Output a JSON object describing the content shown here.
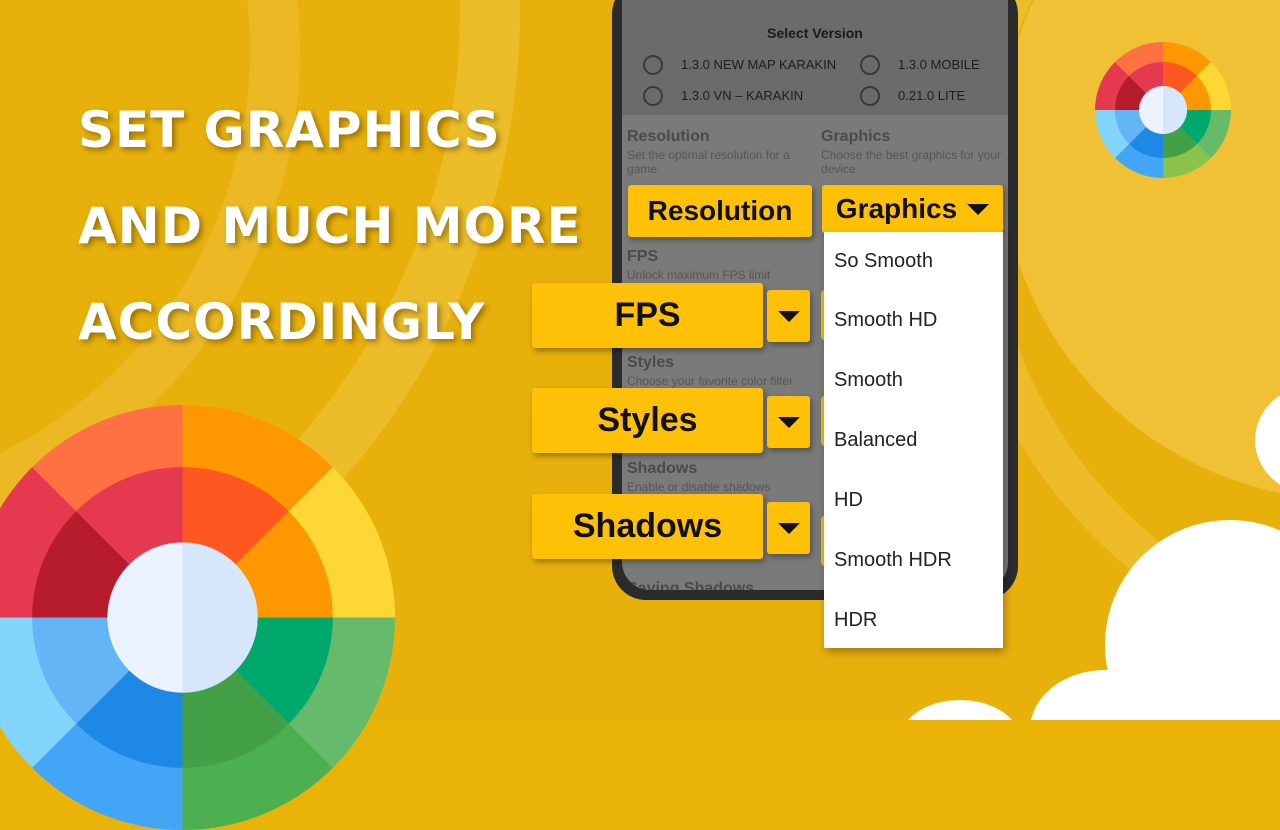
{
  "headline": {
    "lines": [
      "Set Graphics",
      "and much more",
      "accordingly"
    ]
  },
  "phone_screen": {
    "select_version": {
      "title": "Select Version",
      "options": [
        {
          "label": "1.3.0 NEW MAP KARAKIN",
          "selected": false
        },
        {
          "label": "1.3.0 MOBILE",
          "selected": false
        },
        {
          "label": "1.3.0 VN – KARAKIN",
          "selected": false
        },
        {
          "label": "0.21.0 LITE",
          "selected": false
        }
      ]
    },
    "sections": {
      "resolution": {
        "title": "Resolution",
        "subtitle": "Set the optimal resolution for a game"
      },
      "graphics": {
        "title": "Graphics",
        "subtitle": "Choose the best graphics for your device"
      },
      "fps": {
        "title": "FPS",
        "subtitle": "Unlock maximum FPS limit"
      },
      "styles": {
        "title": "Styles",
        "subtitle": "Choose your favorite color filter"
      },
      "shadows": {
        "title": "Shadows",
        "subtitle": "Enable or disable shadows"
      },
      "saving_shadows": {
        "title": "Saving Shadows"
      }
    }
  },
  "buttons": {
    "resolution": "Resolution",
    "graphics": "Graphics",
    "fps": "FPS",
    "styles": "Styles",
    "shadows": "Shadows"
  },
  "graphics_dropdown": {
    "options": [
      "So Smooth",
      "Smooth HD",
      "Smooth",
      "Balanced",
      "HD",
      "Smooth HDR",
      "HDR"
    ]
  },
  "icons": {
    "color_wheel_large": "color-wheel-icon",
    "color_wheel_small": "color-wheel-icon",
    "dropdown_caret": "caret-down-icon"
  },
  "colors": {
    "background": "#e8b00b",
    "button_yellow": "#ffc107",
    "headline_text": "#ffffff"
  }
}
